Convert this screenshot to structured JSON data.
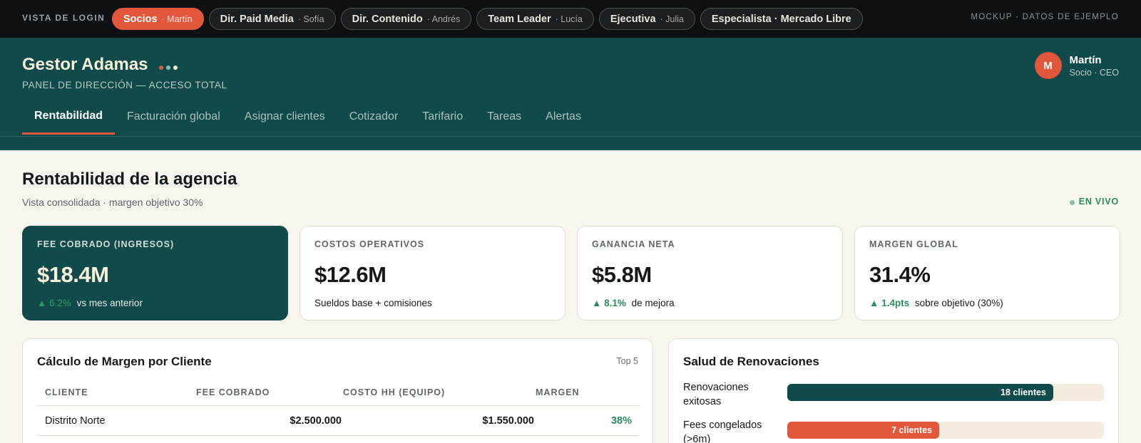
{
  "rolebar": {
    "vista_label": "VISTA DE LOGIN",
    "mockup_label": "MOCKUP · DATOS DE EJEMPLO",
    "roles": [
      {
        "name": "Socios",
        "person": "· Martín"
      },
      {
        "name": "Dir. Paid Media",
        "person": "· Sofía"
      },
      {
        "name": "Dir. Contenido",
        "person": "· Andrés"
      },
      {
        "name": "Team Leader",
        "person": "· Lucía"
      },
      {
        "name": "Ejecutiva",
        "person": "· Julia"
      },
      {
        "name": "Especialista · Mercado Libre",
        "person": ""
      }
    ]
  },
  "header": {
    "brand": "Gestor Adamas",
    "subtitle": "PANEL DE DIRECCIÓN — ACCESO TOTAL",
    "user": {
      "initial": "M",
      "name": "Martín",
      "role": "Socio · CEO"
    },
    "tabs": [
      "Rentabilidad",
      "Facturación global",
      "Asignar clientes",
      "Cotizador",
      "Tarifario",
      "Tareas",
      "Alertas"
    ],
    "active_tab": "Rentabilidad"
  },
  "colors": {
    "accent": "#e2573c",
    "teal": "#114a4b",
    "positive": "#2a8c5c",
    "dot_1": "#e2573c",
    "dot_2": "#7fc3b6",
    "dot_3": "#f8f0d9"
  },
  "page": {
    "title": "Rentabilidad de la agencia",
    "subtitle": "Vista consolidada · margen objetivo 30%",
    "live": "EN VIVO"
  },
  "kpis": [
    {
      "label": "FEE COBRADO (INGRESOS)",
      "value": "$18.4M",
      "delta": "▲ 6.2%",
      "note": "vs mes anterior"
    },
    {
      "label": "COSTOS OPERATIVOS",
      "value": "$12.6M",
      "delta": "",
      "note": "Sueldos base + comisiones"
    },
    {
      "label": "GANANCIA NETA",
      "value": "$5.8M",
      "delta": "▲ 8.1%",
      "note": "de mejora"
    },
    {
      "label": "MARGEN GLOBAL",
      "value": "31.4%",
      "delta": "▲ 1.4pts",
      "note": "sobre objetivo (30%)"
    }
  ],
  "margin_table": {
    "title": "Cálculo de Margen por Cliente",
    "tag": "Top 5",
    "columns": [
      "CLIENTE",
      "FEE COBRADO",
      "COSTO HH (EQUIPO)",
      "MARGEN"
    ],
    "rows": [
      {
        "client": "Distrito Norte",
        "fee": "$2.500.000",
        "cost": "$1.550.000",
        "margin": "38%"
      }
    ]
  },
  "renewals": {
    "title": "Salud de Renovaciones",
    "items": [
      {
        "label": "Renovaciones exitosas",
        "value": "18 clientes",
        "fraction": 0.84,
        "color": "#114a4b"
      },
      {
        "label": "Fees congelados (>6m)",
        "value": "7 clientes",
        "fraction": 0.48,
        "color": "#e2573c"
      }
    ]
  }
}
